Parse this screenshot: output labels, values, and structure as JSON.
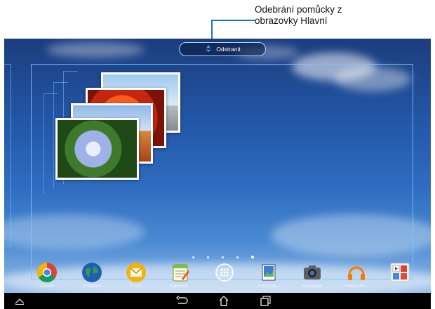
{
  "callout": {
    "line1": "Odebrání pomůcky z",
    "line2": "obrazovky Hlavní"
  },
  "remove_bar": {
    "label": "Odstranit",
    "icon": "recycle-icon"
  },
  "widget": {
    "name": "photo-gallery-widget"
  },
  "page_indicator": {
    "count": 5
  },
  "dock": {
    "apps": [
      {
        "label": "Chrome",
        "icon": "chrome-icon"
      },
      {
        "label": "Prohlížeč",
        "icon": "browser-globe-icon"
      },
      {
        "label": "E-mail",
        "icon": "email-icon"
      },
      {
        "label": "SuperNot...",
        "icon": "supernote-icon"
      },
      {
        "label": "",
        "icon": "all-apps-icon"
      },
      {
        "label": "ASUS Stu...",
        "icon": "asus-studio-icon"
      },
      {
        "label": "Fotoaparát",
        "icon": "camera-icon"
      },
      {
        "label": "Hudba Pla...",
        "icon": "headphones-icon"
      },
      {
        "label": "",
        "icon": "google-apps-folder-icon"
      }
    ]
  },
  "navbar": {
    "buttons": [
      "collapse-icon",
      "back-icon",
      "home-icon",
      "recent-apps-icon"
    ]
  },
  "colors": {
    "accent": "#1e6fd0",
    "frame": "#78c8ff",
    "navbar": "#000000"
  }
}
